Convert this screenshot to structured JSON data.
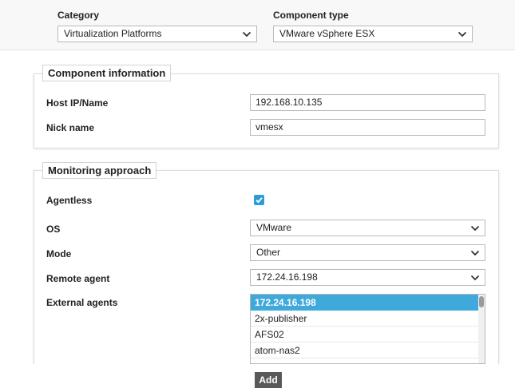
{
  "filters": {
    "category_label": "Category",
    "category_value": "Virtualization Platforms",
    "component_type_label": "Component type",
    "component_type_value": "VMware vSphere ESX"
  },
  "component_info": {
    "title": "Component information",
    "host_label": "Host IP/Name",
    "host_value": "192.168.10.135",
    "nick_label": "Nick name",
    "nick_value": "vmesx"
  },
  "monitoring": {
    "title": "Monitoring approach",
    "agentless_label": "Agentless",
    "agentless_checked": true,
    "os_label": "OS",
    "os_value": "VMware",
    "mode_label": "Mode",
    "mode_value": "Other",
    "remote_agent_label": "Remote agent",
    "remote_agent_value": "172.24.16.198",
    "external_agents_label": "External agents",
    "external_agents": [
      {
        "label": "172.24.16.198",
        "selected": true
      },
      {
        "label": "2x-publisher",
        "selected": false
      },
      {
        "label": "AFS02",
        "selected": false
      },
      {
        "label": "atom-nas2",
        "selected": false
      },
      {
        "label": "",
        "selected": false
      }
    ]
  },
  "actions": {
    "add_label": "Add"
  },
  "colors": {
    "accent": "#2e9bd6",
    "selected_row": "#3fa9dc",
    "button_bg": "#595959"
  }
}
